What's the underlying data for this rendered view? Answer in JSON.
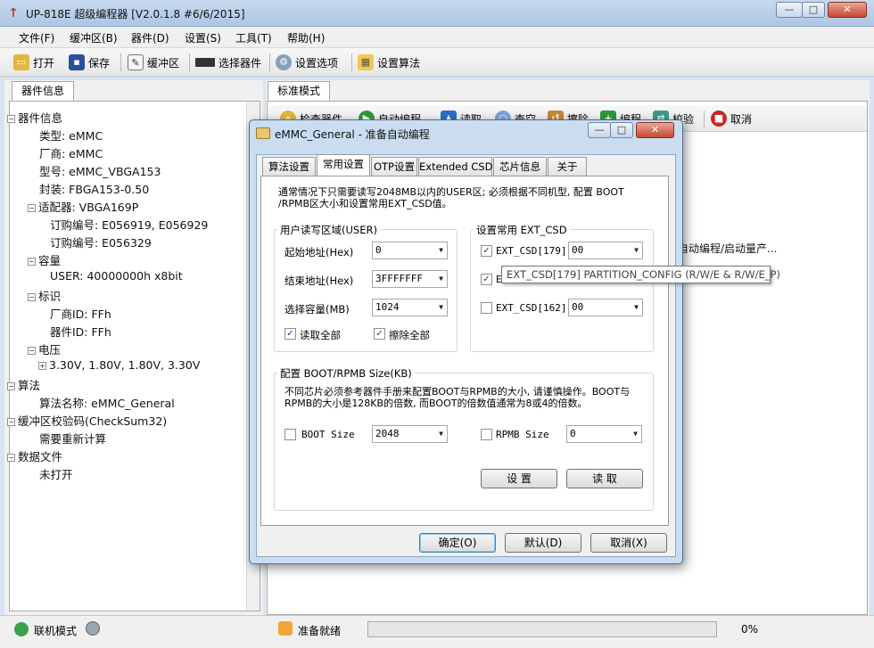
{
  "window": {
    "title": "UP-818E 超级编程器  [V2.0.1.8 #6/6/2015]",
    "min": "—",
    "max": "□",
    "close": "✕"
  },
  "menu": [
    "文件(F)",
    "缓冲区(B)",
    "器件(D)",
    "设置(S)",
    "工具(T)",
    "帮助(H)"
  ],
  "toolbar": {
    "open": "打开",
    "save": "保存",
    "buffer": "缓冲区",
    "select_device": "选择器件",
    "settings": "设置选项",
    "algo": "设置算法"
  },
  "left_panel": {
    "tab": "器件信息",
    "tree": [
      {
        "label": "器件信息",
        "level": 0,
        "exp": "−"
      },
      {
        "label": "类型: eMMC",
        "level": 1
      },
      {
        "label": "厂商: eMMC",
        "level": 1
      },
      {
        "label": "型号: eMMC_VBGA153",
        "level": 1
      },
      {
        "label": "封装: FBGA153-0.50",
        "level": 1
      },
      {
        "label": "适配器: VBGA169P",
        "level": 1,
        "exp": "−"
      },
      {
        "label": "订购编号: E056919, E056929",
        "level": 2
      },
      {
        "label": "订购编号: E056329",
        "level": 2
      },
      {
        "label": "容量",
        "level": 1,
        "exp": "−"
      },
      {
        "label": "USER: 40000000h x8bit",
        "level": 2
      },
      {
        "label": "标识",
        "level": 1,
        "exp": "−"
      },
      {
        "label": "厂商ID: FFh",
        "level": 2
      },
      {
        "label": "器件ID: FFh",
        "level": 2
      },
      {
        "label": "电压",
        "level": 1,
        "exp": "−"
      },
      {
        "label": "3.30V, 1.80V, 1.80V, 3.30V",
        "level": 2,
        "exp": "+"
      },
      {
        "label": "算法",
        "level": 0,
        "exp": "−"
      },
      {
        "label": "算法名称: eMMC_General",
        "level": 1
      },
      {
        "label": "缓冲区校验码(CheckSum32)",
        "level": 0,
        "exp": "−"
      },
      {
        "label": "需要重新计算",
        "level": 1
      },
      {
        "label": "数据文件",
        "level": 0,
        "exp": "−"
      },
      {
        "label": "未打开",
        "level": 1
      }
    ]
  },
  "right_panel": {
    "tab": "标准模式",
    "toolbar": [
      "检查器件",
      "自动编程",
      "读取",
      "查空",
      "擦除",
      "编程",
      "校验",
      "取消"
    ],
    "log_line": "自动编程/启动量产..."
  },
  "status": {
    "mode": "联机模式",
    "ready": "准备就绪",
    "progress_pct": 0,
    "progress_text": "0%"
  },
  "dialog": {
    "title": "eMMC_General - 准备自动编程",
    "tabs": [
      "算法设置",
      "常用设置",
      "OTP设置",
      "Extended CSD",
      "芯片信息",
      "关于"
    ],
    "active_tab": 1,
    "note": "通常情况下只需要读写2048MB以内的USER区; 必须根据不同机型, 配置 BOOT /RPMB区大小和设置常用EXT_CSD值。",
    "user_group": {
      "legend": "用户读写区域(USER)",
      "start_label": "起始地址(Hex)",
      "start_value": "0",
      "end_label": "结束地址(Hex)",
      "end_value": "3FFFFFFF",
      "cap_label": "选择容量(MB)",
      "cap_value": "1024",
      "read_all": "读取全部",
      "erase_all": "擦除全部"
    },
    "csd_group": {
      "legend": "设置常用 EXT_CSD",
      "rows": [
        {
          "label": "EXT_CSD[179]",
          "checked": true,
          "value": "00"
        },
        {
          "label": "E",
          "checked": true,
          "value": ""
        },
        {
          "label": "EXT_CSD[162]",
          "checked": false,
          "value": "00"
        }
      ]
    },
    "boot_group": {
      "legend": "配置 BOOT/RPMB Size(KB)",
      "note": "不同芯片必须参考器件手册来配置BOOT与RPMB的大小, 请谨慎操作。BOOT与RPMB的大小是128KB的倍数, 而BOOT的倍数值通常为8或4的倍数。",
      "boot_label": "BOOT Size",
      "boot_value": "2048",
      "rpmb_label": "RPMB Size",
      "rpmb_value": "0",
      "set_btn": "设  置",
      "read_btn": "读  取"
    },
    "ok": "确定(O)",
    "default": "默认(D)",
    "cancel": "取消(X)",
    "tooltip": "EXT_CSD[179] PARTITION_CONFIG (R/W/E & R/W/E_P)"
  }
}
